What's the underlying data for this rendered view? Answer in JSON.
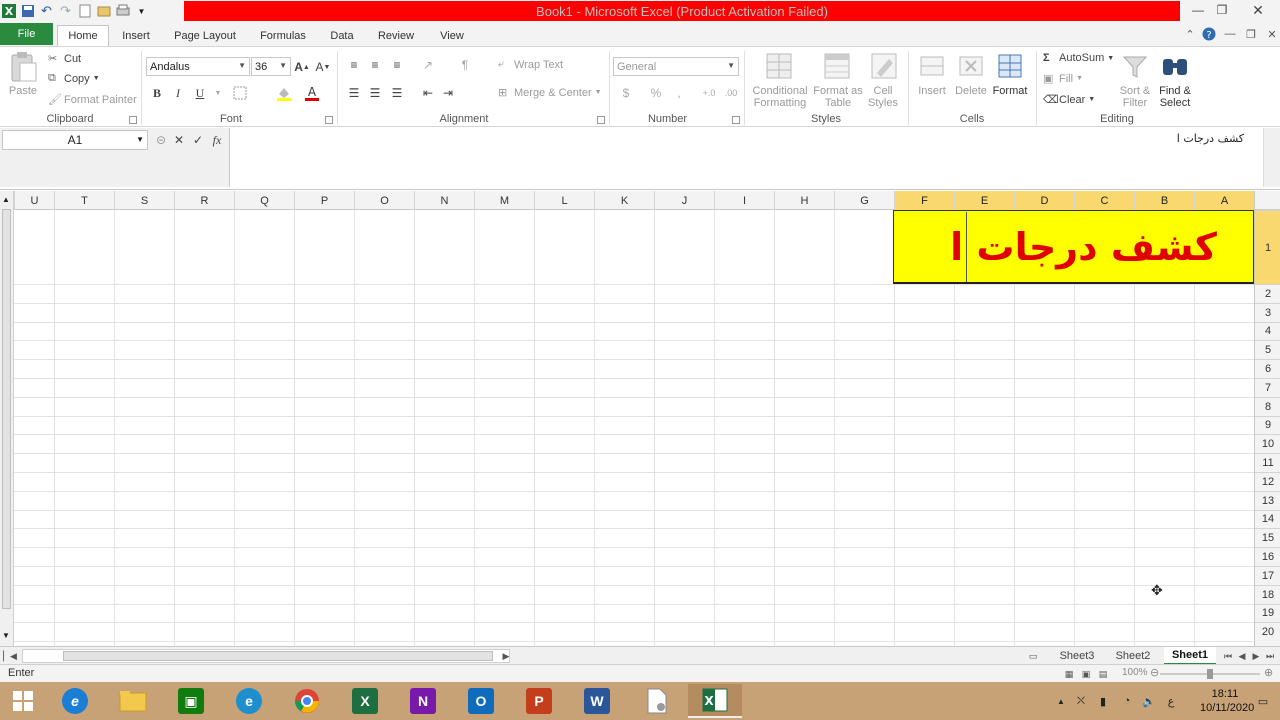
{
  "window": {
    "title": "Book1 - Microsoft Excel (Product Activation Failed)"
  },
  "ribbon_tabs": {
    "file": "File",
    "items": [
      "Home",
      "Insert",
      "Page Layout",
      "Formulas",
      "Data",
      "Review",
      "View"
    ],
    "active": "Home"
  },
  "clipboard": {
    "paste": "Paste",
    "cut": "Cut",
    "copy": "Copy",
    "format_painter": "Format Painter",
    "label": "Clipboard"
  },
  "font": {
    "name": "Andalus",
    "size": "36",
    "bold": "B",
    "italic": "I",
    "underline": "U",
    "label": "Font"
  },
  "alignment": {
    "wrap_text": "Wrap Text",
    "merge_center": "Merge & Center",
    "label": "Alignment"
  },
  "number": {
    "format": "General",
    "percent": "%",
    "comma": ",",
    "label": "Number"
  },
  "styles": {
    "conditional_formatting": "Conditional Formatting",
    "format_as_table": "Format as Table",
    "cell_styles": "Cell Styles",
    "label": "Styles"
  },
  "cells_group": {
    "insert": "Insert",
    "delete": "Delete",
    "format": "Format",
    "label": "Cells"
  },
  "editing": {
    "autosum": "AutoSum",
    "fill": "Fill",
    "clear": "Clear",
    "sort_filter": "Sort & Filter",
    "find_select": "Find & Select",
    "label": "Editing"
  },
  "formula_bar": {
    "name_box": "A1",
    "content": "كشف درجات ا"
  },
  "grid": {
    "columns": [
      "U",
      "T",
      "S",
      "R",
      "Q",
      "P",
      "O",
      "N",
      "M",
      "L",
      "K",
      "J",
      "I",
      "H",
      "G",
      "F",
      "E",
      "D",
      "C",
      "B",
      "A"
    ],
    "selected_columns": [
      "F",
      "E",
      "D",
      "C",
      "B",
      "A"
    ],
    "rows": [
      "1",
      "2",
      "3",
      "4",
      "5",
      "6",
      "7",
      "8",
      "9",
      "10",
      "11",
      "12",
      "13",
      "14",
      "15",
      "16",
      "17",
      "18",
      "19",
      "20"
    ],
    "selected_row": "1",
    "merged_cell_text": "كشف درجات ا",
    "merged_fill_color": "#ffff00",
    "merged_text_color": "#e00000"
  },
  "sheets": {
    "tabs": [
      "Sheet3",
      "Sheet2",
      "Sheet1"
    ],
    "active": "Sheet1"
  },
  "status": {
    "mode": "Enter",
    "zoom": "100%"
  },
  "taskbar": {
    "apps": [
      "start-icon",
      "internet-explorer-icon",
      "file-explorer-icon",
      "store-icon",
      "edge-icon",
      "chrome-icon",
      "excel-icon",
      "onenote-icon",
      "outlook-icon",
      "powerpoint-icon",
      "word-icon",
      "file-icon",
      "excel-active-icon"
    ],
    "language": "ع",
    "time": "18:11",
    "date": "10/11/2020"
  },
  "colors": {
    "file_tab": "#2a8a3e",
    "title_alert": "#ff0000",
    "taskbar": "#c8a277",
    "selected_header": "#f9d870"
  }
}
